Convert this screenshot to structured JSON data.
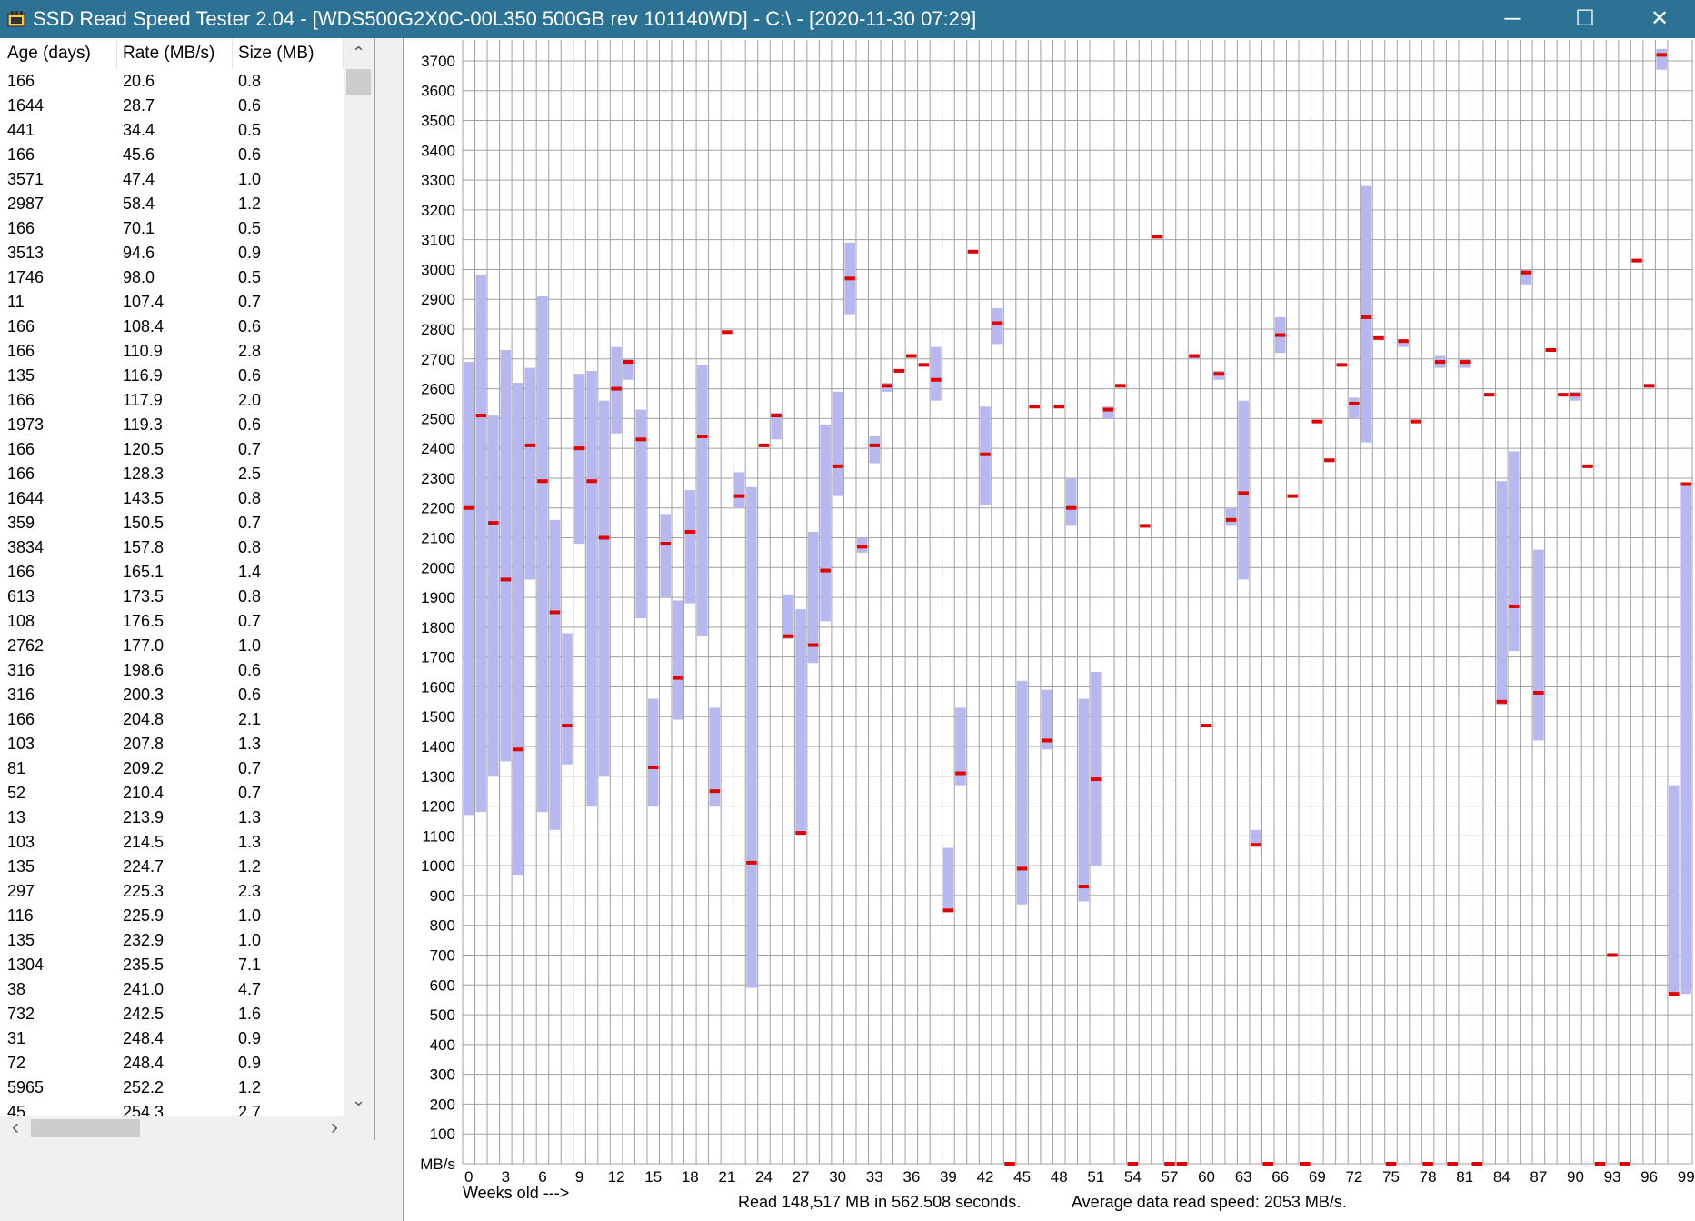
{
  "window": {
    "title": "SSD Read Speed Tester 2.04 - [WDS500G2X0C-00L350 500GB rev 101140WD] - C:\\ - [2020-11-30 07:29]",
    "min_glyph": "─",
    "max_glyph": "☐",
    "close_glyph": "✕"
  },
  "table": {
    "columns": [
      "Age (days)",
      "Rate (MB/s)",
      "Size (MB)"
    ],
    "rows": [
      [
        "166",
        "20.6",
        "0.8"
      ],
      [
        "1644",
        "28.7",
        "0.6"
      ],
      [
        "441",
        "34.4",
        "0.5"
      ],
      [
        "166",
        "45.6",
        "0.6"
      ],
      [
        "3571",
        "47.4",
        "1.0"
      ],
      [
        "2987",
        "58.4",
        "1.2"
      ],
      [
        "166",
        "70.1",
        "0.5"
      ],
      [
        "3513",
        "94.6",
        "0.9"
      ],
      [
        "1746",
        "98.0",
        "0.5"
      ],
      [
        "11",
        "107.4",
        "0.7"
      ],
      [
        "166",
        "108.4",
        "0.6"
      ],
      [
        "166",
        "110.9",
        "2.8"
      ],
      [
        "135",
        "116.9",
        "0.6"
      ],
      [
        "166",
        "117.9",
        "2.0"
      ],
      [
        "1973",
        "119.3",
        "0.6"
      ],
      [
        "166",
        "120.5",
        "0.7"
      ],
      [
        "166",
        "128.3",
        "2.5"
      ],
      [
        "1644",
        "143.5",
        "0.8"
      ],
      [
        "359",
        "150.5",
        "0.7"
      ],
      [
        "3834",
        "157.8",
        "0.8"
      ],
      [
        "166",
        "165.1",
        "1.4"
      ],
      [
        "613",
        "173.5",
        "0.8"
      ],
      [
        "108",
        "176.5",
        "0.7"
      ],
      [
        "2762",
        "177.0",
        "1.0"
      ],
      [
        "316",
        "198.6",
        "0.6"
      ],
      [
        "316",
        "200.3",
        "0.6"
      ],
      [
        "166",
        "204.8",
        "2.1"
      ],
      [
        "103",
        "207.8",
        "1.3"
      ],
      [
        "81",
        "209.2",
        "0.7"
      ],
      [
        "52",
        "210.4",
        "0.7"
      ],
      [
        "13",
        "213.9",
        "1.3"
      ],
      [
        "103",
        "214.5",
        "1.3"
      ],
      [
        "135",
        "224.7",
        "1.2"
      ],
      [
        "297",
        "225.3",
        "2.3"
      ],
      [
        "116",
        "225.9",
        "1.0"
      ],
      [
        "135",
        "232.9",
        "1.0"
      ],
      [
        "1304",
        "235.5",
        "7.1"
      ],
      [
        "38",
        "241.0",
        "4.7"
      ],
      [
        "732",
        "242.5",
        "1.6"
      ],
      [
        "31",
        "248.4",
        "0.9"
      ],
      [
        "72",
        "248.4",
        "0.9"
      ],
      [
        "5965",
        "252.2",
        "1.2"
      ],
      [
        "45",
        "254.3",
        "2.7"
      ]
    ],
    "scroll_up": "⌃",
    "scroll_down": "⌄",
    "scroll_left": "‹",
    "scroll_right": "›"
  },
  "chart": {
    "y_axis_unit": "MB/s",
    "x_axis_label": "Weeks old --->",
    "footer_read": "Read 148,517 MB in 562.508 seconds.",
    "footer_avg": "Average data read speed: 2053 MB/s.",
    "colors": {
      "range": "#b8b8f0",
      "avg": "#e00000",
      "grid": "#a0a0a0"
    }
  },
  "chart_data": {
    "type": "bar",
    "y_ticks": [
      100,
      200,
      300,
      400,
      500,
      600,
      700,
      800,
      900,
      1000,
      1100,
      1200,
      1300,
      1400,
      1500,
      1600,
      1700,
      1800,
      1900,
      2000,
      2100,
      2200,
      2300,
      2400,
      2500,
      2600,
      2700,
      2800,
      2900,
      3000,
      3100,
      3200,
      3300,
      3400,
      3500,
      3600,
      3700
    ],
    "x_ticks": [
      "0",
      "3",
      "6",
      "9",
      "12",
      "15",
      "18",
      "21",
      "24",
      "27",
      "30",
      "33",
      "36",
      "39",
      "42",
      "45",
      "48",
      "51",
      "54",
      "57",
      "60",
      "63",
      "66",
      "69",
      "72",
      "75",
      "78",
      "81",
      "84",
      "87",
      "90",
      "93",
      "96",
      "99"
    ],
    "ylim": [
      0,
      3770
    ],
    "xlim": [
      0,
      99
    ],
    "grid": true,
    "ranges": [
      {
        "week": 0,
        "low": 1170,
        "high": 2690,
        "avg": 2200
      },
      {
        "week": 1,
        "low": 1180,
        "high": 2980,
        "avg": 2510
      },
      {
        "week": 2,
        "low": 1300,
        "high": 2510,
        "avg": 2150
      },
      {
        "week": 3,
        "low": 1350,
        "high": 2730,
        "avg": 1960
      },
      {
        "week": 4,
        "low": 970,
        "high": 2620,
        "avg": 1390
      },
      {
        "week": 5,
        "low": 1960,
        "high": 2670,
        "avg": 2410
      },
      {
        "week": 6,
        "low": 1180,
        "high": 2910,
        "avg": 2290
      },
      {
        "week": 7,
        "low": 1120,
        "high": 2160,
        "avg": 1850
      },
      {
        "week": 8,
        "low": 1340,
        "high": 1780,
        "avg": 1470
      },
      {
        "week": 9,
        "low": 2080,
        "high": 2650,
        "avg": 2400
      },
      {
        "week": 10,
        "low": 1200,
        "high": 2660,
        "avg": 2290
      },
      {
        "week": 11,
        "low": 1300,
        "high": 2560,
        "avg": 2100
      },
      {
        "week": 12,
        "low": 2450,
        "high": 2740,
        "avg": 2600
      },
      {
        "week": 13,
        "low": 2630,
        "high": 2700,
        "avg": 2690
      },
      {
        "week": 14,
        "low": 1830,
        "high": 2530,
        "avg": 2430
      },
      {
        "week": 15,
        "low": 1200,
        "high": 1560,
        "avg": 1330
      },
      {
        "week": 16,
        "low": 1900,
        "high": 2180,
        "avg": 2080
      },
      {
        "week": 17,
        "low": 1490,
        "high": 1890,
        "avg": 1630
      },
      {
        "week": 18,
        "low": 1880,
        "high": 2260,
        "avg": 2120
      },
      {
        "week": 19,
        "low": 1770,
        "high": 2680,
        "avg": 2440
      },
      {
        "week": 20,
        "low": 1200,
        "high": 1530,
        "avg": 1250
      },
      {
        "week": 21,
        "low": 2790,
        "high": 2790,
        "avg": 2790
      },
      {
        "week": 22,
        "low": 2200,
        "high": 2320,
        "avg": 2240
      },
      {
        "week": 23,
        "low": 590,
        "high": 2270,
        "avg": 1010
      },
      {
        "week": 24,
        "low": 2410,
        "high": 2410,
        "avg": 2410
      },
      {
        "week": 25,
        "low": 2430,
        "high": 2520,
        "avg": 2510
      },
      {
        "week": 26,
        "low": 1760,
        "high": 1910,
        "avg": 1770
      },
      {
        "week": 27,
        "low": 1110,
        "high": 1860,
        "avg": 1110
      },
      {
        "week": 28,
        "low": 1680,
        "high": 2120,
        "avg": 1740
      },
      {
        "week": 29,
        "low": 1820,
        "high": 2480,
        "avg": 1990
      },
      {
        "week": 30,
        "low": 2240,
        "high": 2590,
        "avg": 2340
      },
      {
        "week": 31,
        "low": 2850,
        "high": 3090,
        "avg": 2970
      },
      {
        "week": 32,
        "low": 2050,
        "high": 2100,
        "avg": 2070
      },
      {
        "week": 33,
        "low": 2350,
        "high": 2440,
        "avg": 2410
      },
      {
        "week": 34,
        "low": 2590,
        "high": 2620,
        "avg": 2610
      },
      {
        "week": 35,
        "low": 2660,
        "high": 2660,
        "avg": 2660
      },
      {
        "week": 36,
        "low": 2710,
        "high": 2710,
        "avg": 2710
      },
      {
        "week": 37,
        "low": 2680,
        "high": 2680,
        "avg": 2680
      },
      {
        "week": 38,
        "low": 2560,
        "high": 2740,
        "avg": 2630
      },
      {
        "week": 39,
        "low": 850,
        "high": 1060,
        "avg": 850
      },
      {
        "week": 40,
        "low": 1270,
        "high": 1530,
        "avg": 1310
      },
      {
        "week": 41,
        "low": 3060,
        "high": 3060,
        "avg": 3060
      },
      {
        "week": 42,
        "low": 2210,
        "high": 2540,
        "avg": 2380
      },
      {
        "week": 43,
        "low": 2750,
        "high": 2870,
        "avg": 2820
      },
      {
        "week": 44,
        "low": 0,
        "high": 0,
        "avg": 0
      },
      {
        "week": 45,
        "low": 870,
        "high": 1620,
        "avg": 990
      },
      {
        "week": 46,
        "low": 2540,
        "high": 2540,
        "avg": 2540
      },
      {
        "week": 47,
        "low": 1390,
        "high": 1590,
        "avg": 1420
      },
      {
        "week": 48,
        "low": 2540,
        "high": 2540,
        "avg": 2540
      },
      {
        "week": 49,
        "low": 2140,
        "high": 2300,
        "avg": 2200
      },
      {
        "week": 50,
        "low": 880,
        "high": 1560,
        "avg": 930
      },
      {
        "week": 51,
        "low": 1000,
        "high": 1650,
        "avg": 1290
      },
      {
        "week": 52,
        "low": 2500,
        "high": 2540,
        "avg": 2530
      },
      {
        "week": 53,
        "low": 2610,
        "high": 2610,
        "avg": 2610
      },
      {
        "week": 54,
        "low": 0,
        "high": 0,
        "avg": 0
      },
      {
        "week": 55,
        "low": 2140,
        "high": 2140,
        "avg": 2140
      },
      {
        "week": 56,
        "low": 3110,
        "high": 3110,
        "avg": 3110
      },
      {
        "week": 57,
        "low": 0,
        "high": 0,
        "avg": 0
      },
      {
        "week": 58,
        "low": 0,
        "high": 0,
        "avg": 0
      },
      {
        "week": 59,
        "low": 2700,
        "high": 2710,
        "avg": 2710
      },
      {
        "week": 60,
        "low": 1470,
        "high": 1470,
        "avg": 1470
      },
      {
        "week": 61,
        "low": 2630,
        "high": 2660,
        "avg": 2650
      },
      {
        "week": 62,
        "low": 2140,
        "high": 2200,
        "avg": 2160
      },
      {
        "week": 63,
        "low": 1960,
        "high": 2560,
        "avg": 2250
      },
      {
        "week": 64,
        "low": 1070,
        "high": 1120,
        "avg": 1070
      },
      {
        "week": 65,
        "low": 0,
        "high": 0,
        "avg": 0
      },
      {
        "week": 66,
        "low": 2720,
        "high": 2840,
        "avg": 2780
      },
      {
        "week": 67,
        "low": 2240,
        "high": 2240,
        "avg": 2240
      },
      {
        "week": 68,
        "low": 0,
        "high": 0,
        "avg": 0
      },
      {
        "week": 69,
        "low": 2490,
        "high": 2490,
        "avg": 2490
      },
      {
        "week": 70,
        "low": 2360,
        "high": 2360,
        "avg": 2360
      },
      {
        "week": 71,
        "low": 2680,
        "high": 2680,
        "avg": 2680
      },
      {
        "week": 72,
        "low": 2500,
        "high": 2570,
        "avg": 2550
      },
      {
        "week": 73,
        "low": 2420,
        "high": 3280,
        "avg": 2840
      },
      {
        "week": 74,
        "low": 2770,
        "high": 2770,
        "avg": 2770
      },
      {
        "week": 75,
        "low": 0,
        "high": 0,
        "avg": 0
      },
      {
        "week": 76,
        "low": 2740,
        "high": 2760,
        "avg": 2760
      },
      {
        "week": 77,
        "low": 2490,
        "high": 2490,
        "avg": 2490
      },
      {
        "week": 78,
        "low": 0,
        "high": 0,
        "avg": 0
      },
      {
        "week": 79,
        "low": 2670,
        "high": 2710,
        "avg": 2690
      },
      {
        "week": 80,
        "low": 0,
        "high": 0,
        "avg": 0
      },
      {
        "week": 81,
        "low": 2670,
        "high": 2700,
        "avg": 2690
      },
      {
        "week": 82,
        "low": 0,
        "high": 0,
        "avg": 0
      },
      {
        "week": 83,
        "low": 2580,
        "high": 2580,
        "avg": 2580
      },
      {
        "week": 84,
        "low": 1540,
        "high": 2290,
        "avg": 1550
      },
      {
        "week": 85,
        "low": 1720,
        "high": 2390,
        "avg": 1870
      },
      {
        "week": 86,
        "low": 2950,
        "high": 3000,
        "avg": 2990
      },
      {
        "week": 87,
        "low": 1420,
        "high": 2060,
        "avg": 1580
      },
      {
        "week": 88,
        "low": 2730,
        "high": 2730,
        "avg": 2730
      },
      {
        "week": 89,
        "low": 2580,
        "high": 2580,
        "avg": 2580
      },
      {
        "week": 90,
        "low": 2560,
        "high": 2590,
        "avg": 2580
      },
      {
        "week": 91,
        "low": 2340,
        "high": 2340,
        "avg": 2340
      },
      {
        "week": 92,
        "low": 0,
        "high": 0,
        "avg": 0
      },
      {
        "week": 93,
        "low": 700,
        "high": 700,
        "avg": 700
      },
      {
        "week": 94,
        "low": 0,
        "high": 0,
        "avg": 0
      },
      {
        "week": 95,
        "low": 3030,
        "high": 3030,
        "avg": 3030
      },
      {
        "week": 96,
        "low": 2610,
        "high": 2610,
        "avg": 2610
      },
      {
        "week": 97,
        "low": 3670,
        "high": 3740,
        "avg": 3720
      },
      {
        "week": 98,
        "low": 570,
        "high": 1270,
        "avg": 570
      },
      {
        "week": 99,
        "low": 570,
        "high": 2280,
        "avg": 2280
      }
    ]
  }
}
